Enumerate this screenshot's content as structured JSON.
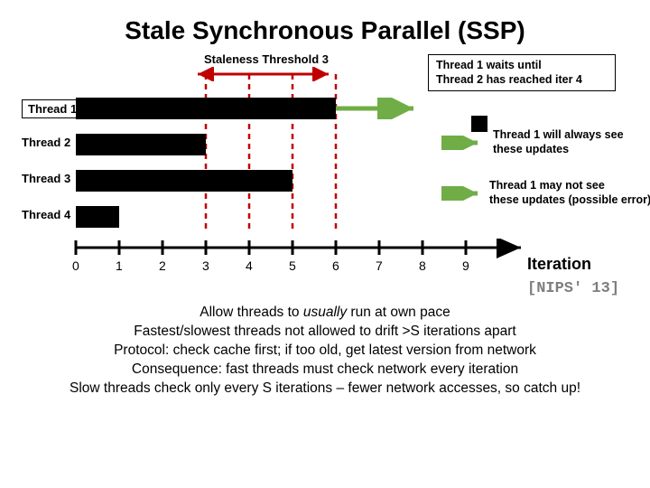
{
  "title": "Stale Synchronous Parallel (SSP)",
  "staleness_label": "Staleness Threshold 3",
  "wait_note": "Thread 1 waits until\nThread 2 has reached iter 4",
  "threads": [
    "Thread 1",
    "Thread 2",
    "Thread 3",
    "Thread 4"
  ],
  "legend1": "Thread 1 will always see\nthese updates",
  "legend2": "Thread 1 may not see\nthese updates (possible error)",
  "iteration_label": "Iteration",
  "citation": "[NIPS' 13]",
  "ticks": [
    "0",
    "1",
    "2",
    "3",
    "4",
    "5",
    "6",
    "7",
    "8",
    "9"
  ],
  "body": {
    "l1a": "Allow threads to ",
    "l1b": "usually",
    "l1c": " run at own pace",
    "l2": "Fastest/slowest threads not allowed to drift >S iterations apart",
    "l3": "Protocol: check cache first; if too old, get latest version from network",
    "l4": "Consequence: fast threads must check network every iteration",
    "l5": "Slow threads check only every S iterations – fewer network accesses, so catch up!"
  },
  "chart_data": {
    "type": "bar",
    "title": "Stale Synchronous Parallel timeline",
    "xlabel": "Iteration",
    "xlim": [
      0,
      9
    ],
    "staleness_threshold": 3,
    "threshold_span": [
      3,
      6
    ],
    "dashed_ref_lines": [
      3,
      4,
      5,
      6
    ],
    "series": [
      {
        "name": "Thread 1",
        "progress": 6
      },
      {
        "name": "Thread 2",
        "progress": 3
      },
      {
        "name": "Thread 3",
        "progress": 5
      },
      {
        "name": "Thread 4",
        "progress": 1
      }
    ],
    "annotations": [
      "Thread 1 waits until Thread 2 has reached iter 4",
      "Thread 1 will always see these updates (black)",
      "Thread 1 may not see these updates (green, possible error)"
    ]
  }
}
